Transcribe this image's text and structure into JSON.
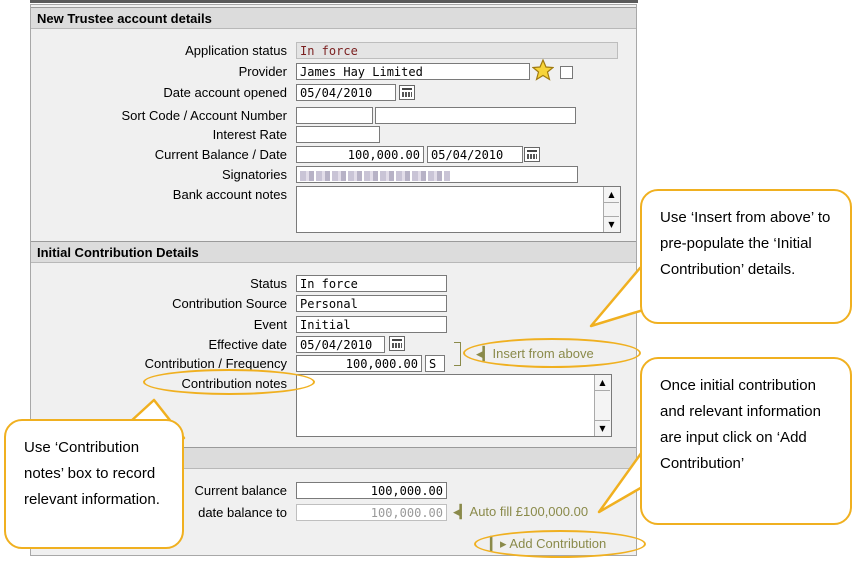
{
  "trustee": {
    "title": "New Trustee account details",
    "application_status_label": "Application status",
    "application_status_value": "In force",
    "provider_label": "Provider",
    "provider_value": "James Hay Limited",
    "date_opened_label": "Date account opened",
    "date_opened_value": "05/04/2010",
    "sort_code_label": "Sort Code / Account Number",
    "sort_code_value": "",
    "account_number_value": "",
    "interest_rate_label": "Interest Rate",
    "interest_rate_value": "",
    "balance_label": "Current Balance / Date",
    "balance_value": "100,000.00",
    "balance_date_value": "05/04/2010",
    "signatories_label": "Signatories",
    "bank_notes_label": "Bank account notes"
  },
  "contribution": {
    "title": "Initial Contribution Details",
    "status_label": "Status",
    "status_value": "In force",
    "source_label": "Contribution Source",
    "source_value": "Personal",
    "event_label": "Event",
    "event_value": "Initial",
    "effective_date_label": "Effective date",
    "effective_date_value": "05/04/2010",
    "freq_label": "Contribution / Frequency",
    "amount_value": "100,000.00",
    "frequency_value": "S",
    "insert_link": "Insert from above",
    "notes_label": "Contribution notes"
  },
  "balance": {
    "current_label": "Current balance",
    "current_value": "100,000.00",
    "update_label": "date balance to",
    "update_value": "100,000.00",
    "autofill_link": "Auto fill £100,000.00",
    "add_link": "Add Contribution"
  },
  "callouts": {
    "insert": "Use ‘Insert from above’ to pre-populate the ‘Initial Contribution’ details.",
    "add": "Once initial contribution and relevant information are input click on ‘Add Contribution’",
    "notes": "Use ‘Contribution notes’ box to record relevant information."
  },
  "colors": {
    "highlight": "#f0b020",
    "link": "#8a8a4a",
    "readonly_text": "#7a1f1f"
  },
  "icons": {
    "favourite": "star-icon",
    "calendar": "calendar-icon"
  }
}
